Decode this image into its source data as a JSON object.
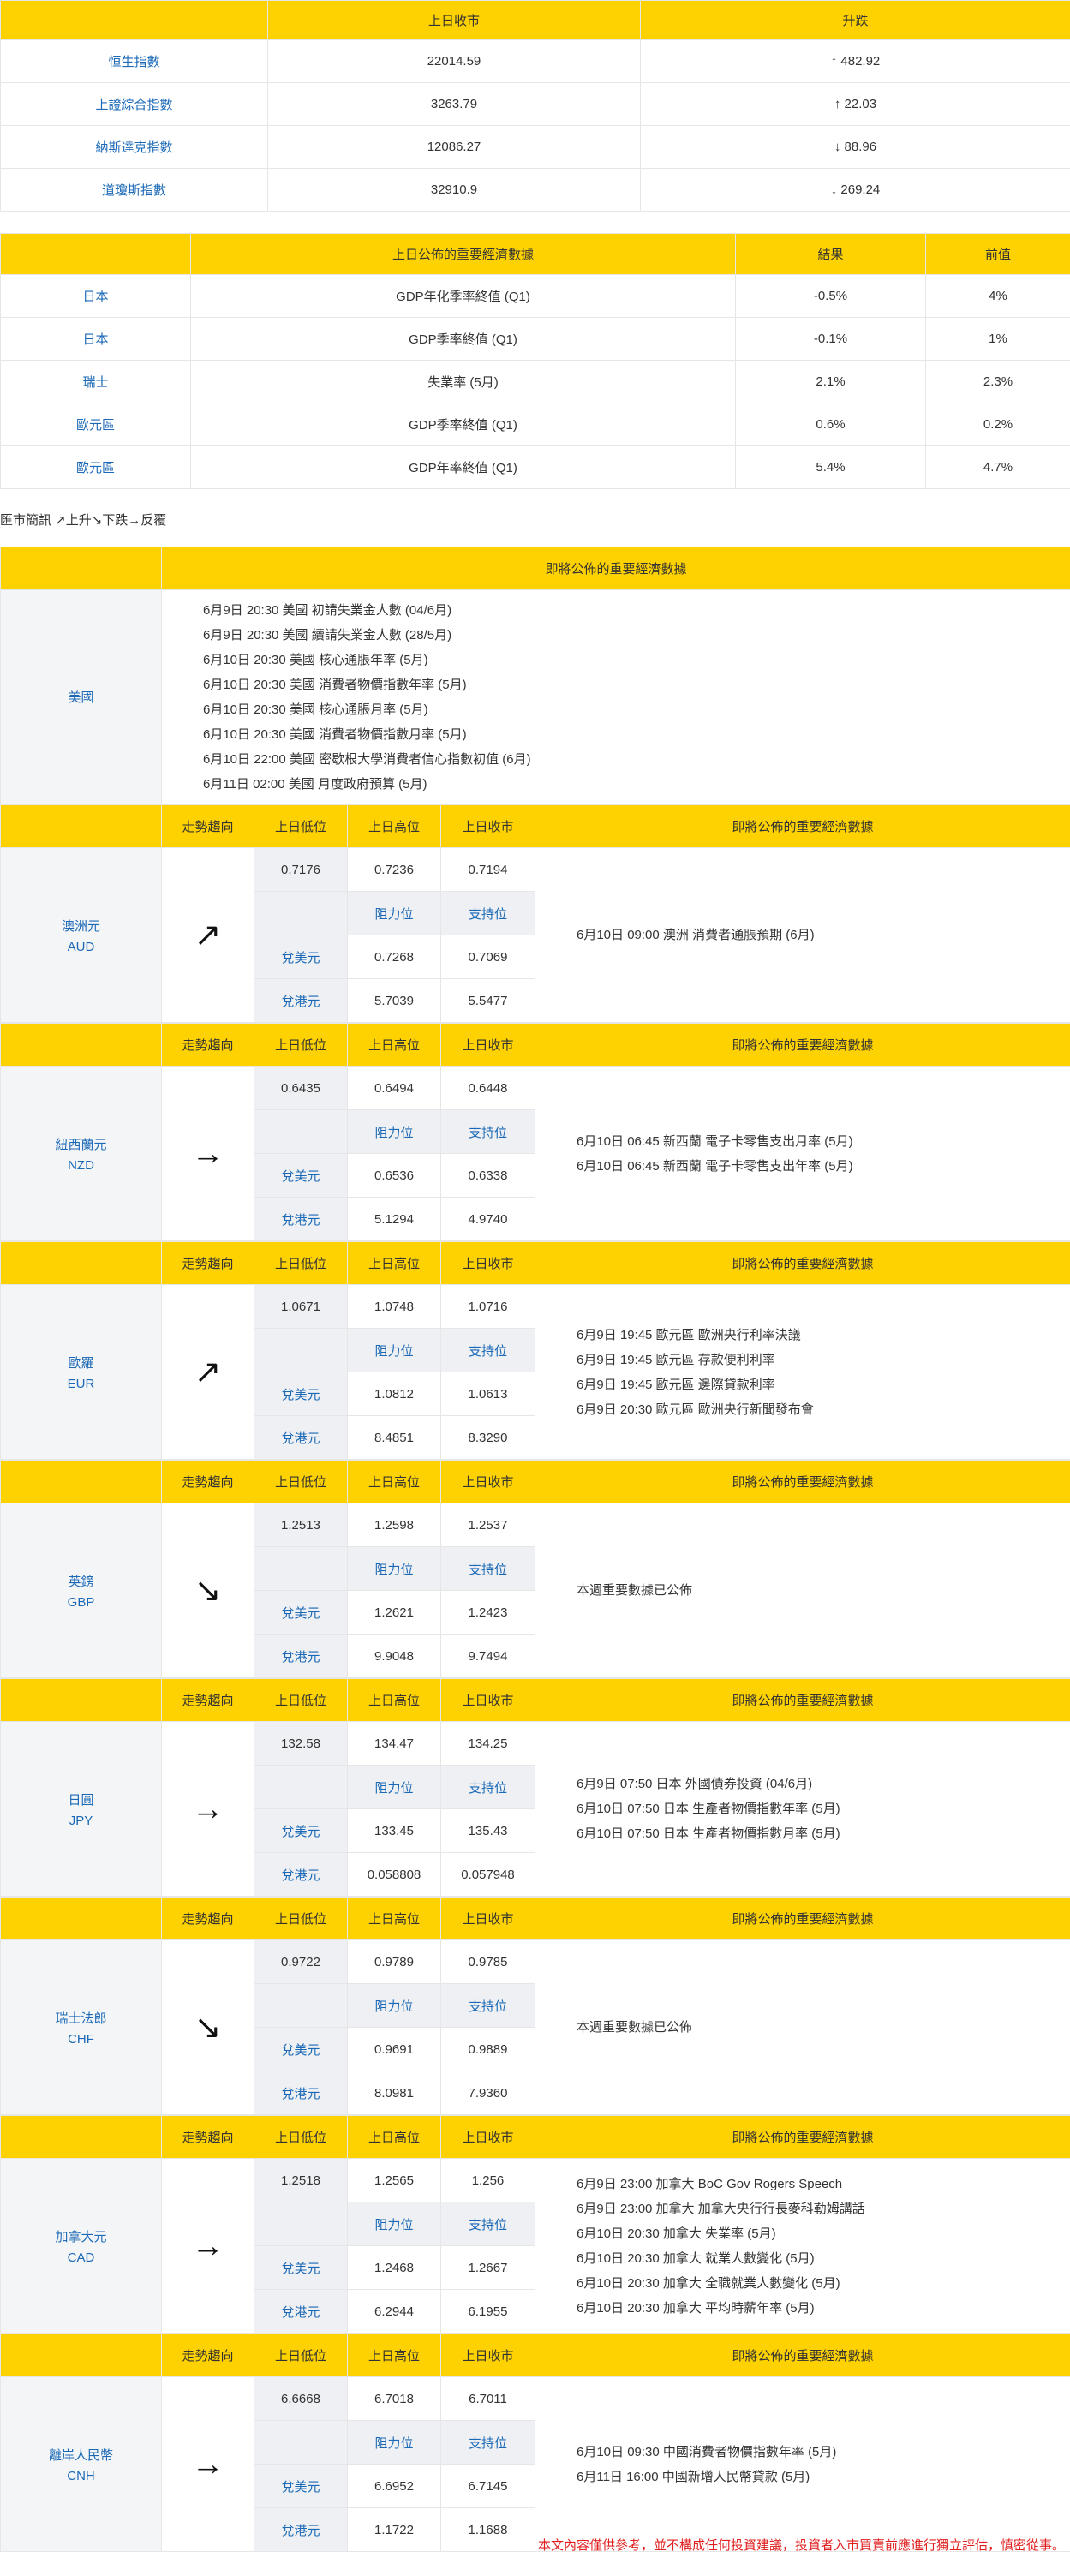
{
  "indices": {
    "headers": [
      "",
      "上日收市",
      "升跌"
    ],
    "rows": [
      {
        "name": "恒生指數",
        "close": "22014.59",
        "change": "↑ 482.92"
      },
      {
        "name": "上證綜合指數",
        "close": "3263.79",
        "change": "↑ 22.03"
      },
      {
        "name": "納斯達克指數",
        "close": "12086.27",
        "change": "↓ 88.96"
      },
      {
        "name": "道瓊斯指數",
        "close": "32910.9",
        "change": "↓ 269.24"
      }
    ]
  },
  "released": {
    "headers": [
      "",
      "上日公佈的重要經濟數據",
      "結果",
      "前值"
    ],
    "rows": [
      {
        "region": "日本",
        "item": "GDP年化季率終值 (Q1)",
        "result": "-0.5%",
        "prev": "4%"
      },
      {
        "region": "日本",
        "item": "GDP季率終值 (Q1)",
        "result": "-0.1%",
        "prev": "1%"
      },
      {
        "region": "瑞士",
        "item": "失業率 (5月)",
        "result": "2.1%",
        "prev": "2.3%"
      },
      {
        "region": "歐元區",
        "item": "GDP季率終值 (Q1)",
        "result": "0.6%",
        "prev": "0.2%"
      },
      {
        "region": "歐元區",
        "item": "GDP年率終值 (Q1)",
        "result": "5.4%",
        "prev": "4.7%"
      }
    ]
  },
  "legend": "匯市簡訊 ↗上升↘下跌→反覆",
  "us": {
    "header": "即將公佈的重要經濟數據",
    "region": "美國",
    "events": [
      "6月9日 20:30  美國 初請失業金人數 (04/6月)",
      "6月9日 20:30  美國 續請失業金人數 (28/5月)",
      "6月10日 20:30  美國 核心通脹年率 (5月)",
      "6月10日 20:30  美國 消費者物價指數年率 (5月)",
      "6月10日 20:30  美國 核心通脹月率 (5月)",
      "6月10日 20:30  美國 消費者物價指數月率 (5月)",
      "6月10日 22:00  美國 密歇根大學消費者信心指數初值 (6月)",
      "6月11日 02:00  美國 月度政府預算 (5月)"
    ]
  },
  "fx_labels": {
    "trend": "走勢趨向",
    "low": "上日低位",
    "high": "上日高位",
    "close": "上日收市",
    "upcoming": "即將公佈的重要經濟數據",
    "resistance": "阻力位",
    "support": "支持位",
    "vs_usd": "兌美元",
    "vs_hkd": "兌港元"
  },
  "currencies": [
    {
      "name": "澳洲元",
      "code": "AUD",
      "trend": "↗",
      "low": "0.7176",
      "high": "0.7236",
      "close": "0.7194",
      "usd_res": "0.7268",
      "usd_sup": "0.7069",
      "hkd_res": "5.7039",
      "hkd_sup": "5.5477",
      "events": [
        "6月10日 09:00  澳洲 消費者通脹預期 (6月)"
      ]
    },
    {
      "name": "紐西蘭元",
      "code": "NZD",
      "trend": "→",
      "low": "0.6435",
      "high": "0.6494",
      "close": "0.6448",
      "usd_res": "0.6536",
      "usd_sup": "0.6338",
      "hkd_res": "5.1294",
      "hkd_sup": "4.9740",
      "events": [
        "6月10日 06:45  新西蘭 電子卡零售支出月率 (5月)",
        "6月10日 06:45  新西蘭 電子卡零售支出年率 (5月)"
      ]
    },
    {
      "name": "歐羅",
      "code": "EUR",
      "trend": "↗",
      "low": "1.0671",
      "high": "1.0748",
      "close": "1.0716",
      "usd_res": "1.0812",
      "usd_sup": "1.0613",
      "hkd_res": "8.4851",
      "hkd_sup": "8.3290",
      "events": [
        "6月9日 19:45  歐元區 歐洲央行利率決議",
        "6月9日 19:45  歐元區 存款便利利率",
        "6月9日 19:45  歐元區 邊際貸款利率",
        "6月9日 20:30  歐元區 歐洲央行新聞發布會"
      ]
    },
    {
      "name": "英鎊",
      "code": "GBP",
      "trend": "↘",
      "low": "1.2513",
      "high": "1.2598",
      "close": "1.2537",
      "usd_res": "1.2621",
      "usd_sup": "1.2423",
      "hkd_res": "9.9048",
      "hkd_sup": "9.7494",
      "events": [
        "本週重要數據已公佈"
      ]
    },
    {
      "name": "日圓",
      "code": "JPY",
      "trend": "→",
      "low": "132.58",
      "high": "134.47",
      "close": "134.25",
      "usd_res": "133.45",
      "usd_sup": "135.43",
      "hkd_res": "0.058808",
      "hkd_sup": "0.057948",
      "events": [
        "6月9日 07:50  日本 外國債券投資 (04/6月)",
        "6月10日 07:50  日本 生產者物價指數年率 (5月)",
        "6月10日 07:50  日本 生產者物價指數月率 (5月)"
      ]
    },
    {
      "name": "瑞士法郎",
      "code": "CHF",
      "trend": "↘",
      "low": "0.9722",
      "high": "0.9789",
      "close": "0.9785",
      "usd_res": "0.9691",
      "usd_sup": "0.9889",
      "hkd_res": "8.0981",
      "hkd_sup": "7.9360",
      "events": [
        "本週重要數據已公佈"
      ]
    },
    {
      "name": "加拿大元",
      "code": "CAD",
      "trend": "→",
      "low": "1.2518",
      "high": "1.2565",
      "close": "1.256",
      "usd_res": "1.2468",
      "usd_sup": "1.2667",
      "hkd_res": "6.2944",
      "hkd_sup": "6.1955",
      "events": [
        "6月9日 23:00  加拿大 BoC Gov Rogers Speech",
        "6月9日 23:00  加拿大 加拿大央行行長麥科勒姆講話",
        "6月10日 20:30  加拿大 失業率 (5月)",
        "6月10日 20:30  加拿大 就業人數變化 (5月)",
        "6月10日 20:30  加拿大 全職就業人數變化 (5月)",
        "6月10日 20:30  加拿大 平均時薪年率 (5月)"
      ]
    },
    {
      "name": "離岸人民幣",
      "code": "CNH",
      "trend": "→",
      "low": "6.6668",
      "high": "6.7018",
      "close": "6.7011",
      "usd_res": "6.6952",
      "usd_sup": "6.7145",
      "hkd_res": "1.1722",
      "hkd_sup": "1.1688",
      "events": [
        "6月10日 09:30  中國消費者物價指數年率 (5月)",
        "6月11日 16:00  中國新增人民幣貸款 (5月)"
      ]
    }
  ],
  "footer": "本文內容僅供參考，並不構成任何投資建議，投資者入市買賣前應進行獨立評估，慎密從事。"
}
